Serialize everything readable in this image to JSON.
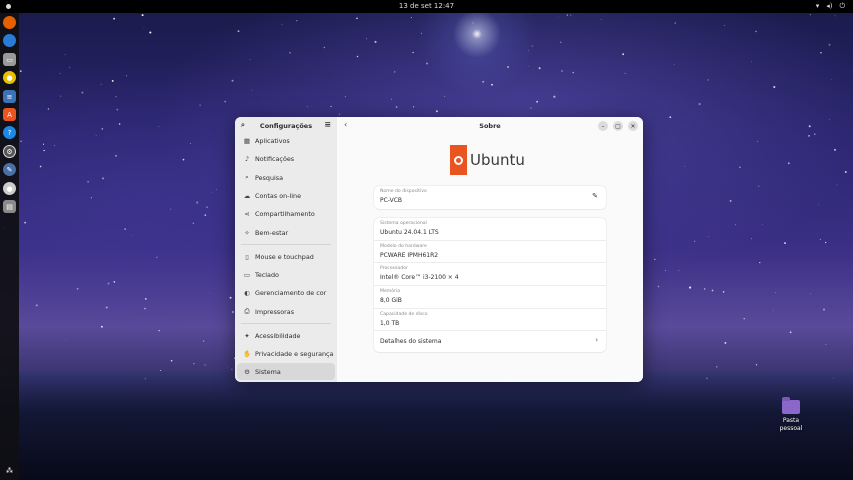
{
  "topbar": {
    "clock": "13 de set  12:47"
  },
  "desktop": {
    "folder_label": "Pasta pessoal"
  },
  "sidebar": {
    "title": "Configurações",
    "items": [
      {
        "label": "Aplicativos",
        "icon": "apps-icon"
      },
      {
        "label": "Notificações",
        "icon": "bell-icon"
      },
      {
        "label": "Pesquisa",
        "icon": "search-icon"
      },
      {
        "label": "Contas on-line",
        "icon": "cloud-icon"
      },
      {
        "label": "Compartilhamento",
        "icon": "share-icon"
      },
      {
        "label": "Bem-estar",
        "icon": "wellbeing-icon"
      },
      {
        "label": "Mouse e touchpad",
        "icon": "mouse-icon"
      },
      {
        "label": "Teclado",
        "icon": "keyboard-icon"
      },
      {
        "label": "Gerenciamento de cor",
        "icon": "color-icon"
      },
      {
        "label": "Impressoras",
        "icon": "printer-icon"
      },
      {
        "label": "Acessibilidade",
        "icon": "accessibility-icon"
      },
      {
        "label": "Privacidade e segurança",
        "icon": "privacy-icon"
      },
      {
        "label": "Sistema",
        "icon": "gear-icon"
      }
    ]
  },
  "content": {
    "title": "Sobre",
    "logo_text": "Ubuntu",
    "device": {
      "label": "Nome do dispositivo",
      "value": "PC-VCB"
    },
    "info": [
      {
        "label": "Sistema operacional",
        "value": "Ubuntu 24.04.1 LTS"
      },
      {
        "label": "Modelo do hardware",
        "value": "PCWARE IPMH61R2"
      },
      {
        "label": "Processador",
        "value": "Intel® Core™ i3-2100 × 4"
      },
      {
        "label": "Memória",
        "value": "8,0 GiB"
      },
      {
        "label": "Capacidade de disco",
        "value": "1,0 TB"
      }
    ],
    "details_label": "Detalhes do sistema"
  },
  "colors": {
    "ubuntu_orange": "#e95420",
    "sidebar_bg": "#ebebeb",
    "active_item": "#d8d8d8"
  }
}
